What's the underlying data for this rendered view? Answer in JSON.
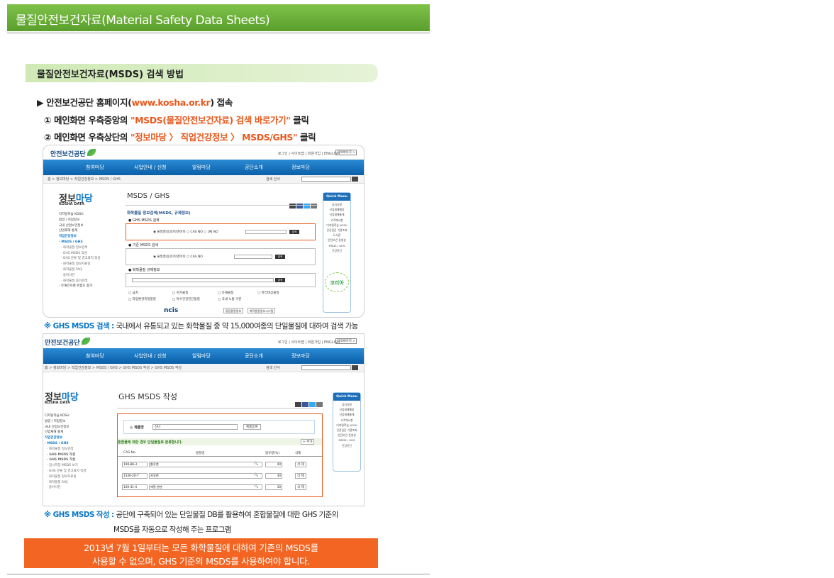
{
  "header": {
    "title": "물질안전보건자료(Material Safety Data Sheets)"
  },
  "section": {
    "title": "물질안전보건자료(MSDS) 검색 방법"
  },
  "steps": {
    "access_prefix": "▶ 안전보건공단 홈페이지(",
    "access_link": "www.kosha.or.kr",
    "access_suffix": ") 접속",
    "step1_prefix": "① 메인화면 우측중앙의 ",
    "step1_highlight": "\"MSDS(물질안전보건자료) 검색 바로가기\"",
    "step1_suffix": " 클릭",
    "step2_prefix": "② 메인화면 우측상단의 ",
    "step2_highlight": "\"정보마당 〉 직업건강정보 〉 MSDS/GHS\"",
    "step2_suffix": " 클릭"
  },
  "site": {
    "logo": "안전보건공단",
    "util": "로그인 | 사이트맵 | 회원가입 | ENGLISH",
    "util_box": "검색페이지 >",
    "nav": [
      "참여마당",
      "사업안내 / 신청",
      "알림마당",
      "공단소개",
      "정보마당"
    ],
    "search_label": "검색 인사",
    "side_title_main": "정보",
    "side_title_hl": "마당",
    "side_sub": "KOSHA DATA",
    "quick_menu": "Quick Menu",
    "quick_items": [
      "공지사항",
      "산업재해예방",
      "산업재해통계",
      "고객게시판",
      "디지털학습 KOSH",
      "건강검진 기관조회",
      "도서관",
      "안전보건 동영상",
      "MSDS / GHS",
      "건강진단"
    ],
    "badge": "코리아",
    "ghs_label": "● GHS MSDS 검색",
    "old_label": "● 기존 MSDS 검색",
    "reg_label": "● 화학물질 규제정보",
    "radio1": "◉ 물질명/동의어/영어이 ○ CAS NO ○ UN NO",
    "radio2": "◉ 물질명/동의어/영어이 ○ CAS NO",
    "search_btn": "검색",
    "checks1": [
      "□ 금지",
      "□ 허가물질",
      "□ 유해물질",
      "□ 관리대상물질"
    ],
    "checks2": [
      "□ 작업환경측정물질",
      "□ 특수건강진단물질",
      "□ 국내 노출 기준"
    ],
    "footer_logo": "ncis",
    "footer_box1": "통합물질정보",
    "footer_box2": "화학물질정보시스템"
  },
  "shot1": {
    "breadcrumb": "홈 > 정보마당 > 직업건강정보 > MSDS / GHS",
    "title": "MSDS / GHS",
    "subhead": "화학물질 정보검색(MSDS, 규제정보)",
    "side_items": [
      "디지털학습 KOSH",
      "법령 / 지침정보",
      "국내 산업보건정보",
      "산업재해 통계",
      "직업건강정보",
      "- MSDS / GHS",
      "· 화학물질 정보검색",
      "· GHS MSDS 작성",
      "· GHS 분류 및 경고표지 작성",
      "· 화학물질 정보자료실",
      "· 화학물질 FAQ",
      "· 용어사전",
      "· 화학물질 용어검색",
      "- 유해인자별 위험도 평가"
    ]
  },
  "note1": {
    "label": "※ GHS MSDS 검색 :",
    "text": " 국내에서 유통되고 있는 화학물질 중 약 15,000여종의 단일물질에 대하여 검색 가능"
  },
  "shot2": {
    "breadcrumb": "홈 > 정보마당 > 직업건강정보 > MSDS / GHS > GHS MSDS 작성 > GHS MSDS 작성",
    "title": "GHS MSDS 작성",
    "product_label": "◎ 제품명",
    "product_value": "신나",
    "product_btn": "제품등록",
    "banner": "혼합물에 대한 경우 단일물질로 분류합니다.",
    "add_btn": "+ 추가",
    "table_headers": [
      "CAS No.",
      "물질명",
      "함유량(%)",
      "삭제"
    ],
    "rows": [
      {
        "cas": "108-88-3",
        "name": "톨루엔",
        "pct": "40",
        "del": "삭 제"
      },
      {
        "cas": "1330-20-7",
        "name": "자일렌",
        "pct": "30",
        "del": "삭 제"
      },
      {
        "cas": "100-41-4",
        "name": "에틸 벤젠",
        "pct": "30",
        "del": "삭 제"
      }
    ],
    "side_items": [
      "디지털학습 KOSH",
      "법령 / 지침정보",
      "국내 산업보건정보",
      "산업재해 통계",
      "직업건강정보",
      "- MSDS / GHS",
      "· 화학물질 정보검색",
      "· GHS MSDS 작성",
      "- GHS MSDS 작성",
      "- 임시저장 MSDS 보기",
      "· GHS 분류 및 경고표지 작성",
      "· 화학물질 정보자료실",
      "· 화학물질 FAQ",
      "· 용어사전"
    ]
  },
  "note2": {
    "label": "※ GHS MSDS 작성 :",
    "text": " 공단에 구축되어 있는 단일물질 DB를 활용하여 혼합물질에 대한 GHS 기준의",
    "text2": "MSDS를 자동으로 작성해 주는 프로그램"
  },
  "warning": {
    "line1": "2013년 7월 1일부터는 모든 화학물질에 대하여 기존의 MSDS를",
    "line2": "사용할 수 없으며, GHS 기준의 MSDS를 사용하여야 합니다."
  },
  "colors": {
    "green": "#6ab03a",
    "orange": "#f26522",
    "blue": "#0b77c7",
    "nav_blue": "#0a5fa8"
  }
}
